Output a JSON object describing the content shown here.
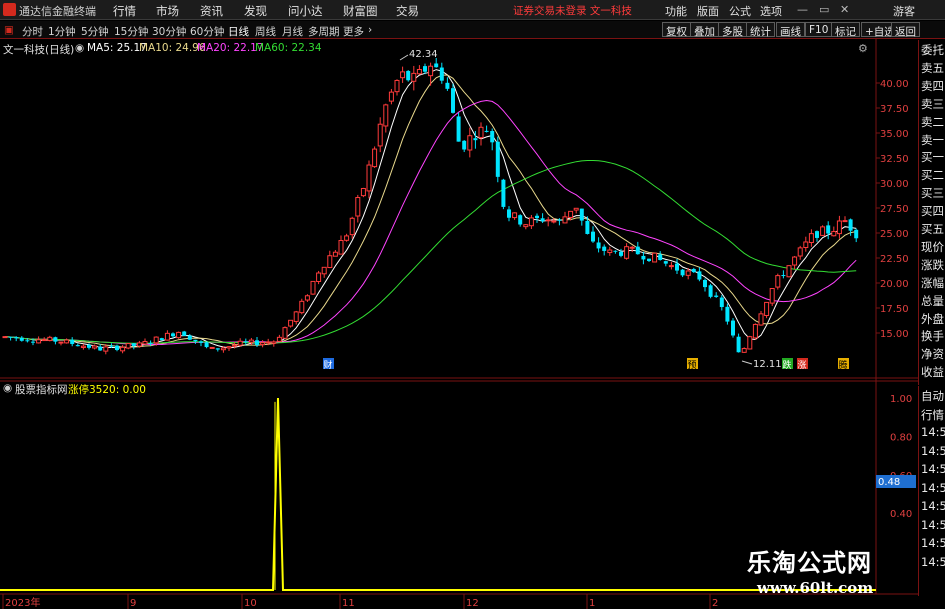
{
  "menubar": {
    "app_title": "通达信金融终端",
    "items": [
      "行情",
      "市场",
      "资讯",
      "发现",
      "问小达",
      "财富圈",
      "交易"
    ],
    "status": "证券交易未登录  文一科技",
    "right_items": [
      "功能",
      "版面",
      "公式",
      "选项"
    ],
    "guest": "游客"
  },
  "periodbar": {
    "periods": [
      "分时",
      "1分钟",
      "5分钟",
      "15分钟",
      "30分钟",
      "60分钟",
      "日线",
      "周线",
      "月线",
      "多周期",
      "更多"
    ],
    "active_period": "日线",
    "right_buttons": [
      "复权",
      "叠加",
      "多股",
      "统计",
      "画线",
      "F10",
      "标记",
      "+自选",
      "返回"
    ]
  },
  "main_header": {
    "stock": "文一科技(日线)",
    "ma5": "MA5: 25.17",
    "ma10": "MA10: 24.96",
    "ma20": "MA20: 22.17",
    "ma60": "MA60: 22.34"
  },
  "sub_header": {
    "name": "股票指标网",
    "indicator": "涨停3520: 0.00"
  },
  "price_axis": [
    "40.00",
    "37.50",
    "35.00",
    "32.50",
    "30.00",
    "27.50",
    "25.00",
    "22.50",
    "20.00",
    "17.50",
    "15.00"
  ],
  "sub_axis": [
    "1.00",
    "0.80",
    "0.60",
    "0.40"
  ],
  "sub_value_box": "0.48",
  "annotations": {
    "high": "42.34",
    "low": "12.11",
    "markers": [
      "财",
      "预",
      "跌",
      "涨",
      "腾"
    ]
  },
  "time_axis": [
    "2023年",
    "9",
    "10",
    "11",
    "12",
    "1",
    "2"
  ],
  "right_panel": [
    "委托",
    "卖五",
    "卖四",
    "卖三",
    "卖二",
    "卖一",
    "买一",
    "买二",
    "买三",
    "买四",
    "买五",
    "现价",
    "涨跌",
    "涨幅",
    "总量",
    "外盘",
    "换手",
    "净资",
    "收益"
  ],
  "right_panel2": [
    "自动",
    "行情",
    "14:50",
    "14:50",
    "14:50",
    "14:50",
    "14:50",
    "14:50",
    "14:50",
    "14:50"
  ],
  "watermark": {
    "line1": "乐淘公式网",
    "line2": "www.60lt.com"
  },
  "colors": {
    "up": "#ff3b3b",
    "down": "#00e5ff",
    "ma5": "#ffffff",
    "ma10": "#e8d88c",
    "ma20": "#ff44ff",
    "ma60": "#33dd33",
    "signal": "#ffff00",
    "frame": "#7a1212"
  },
  "chart_data": {
    "type": "candlestick",
    "series_ma": [
      "MA5",
      "MA10",
      "MA20",
      "MA60"
    ],
    "ylim": [
      12,
      43
    ],
    "high": 42.34,
    "low": 12.11,
    "sub_indicator": {
      "name": "涨停3520",
      "ylim": [
        0,
        1
      ],
      "spike_value": 1.0
    }
  }
}
